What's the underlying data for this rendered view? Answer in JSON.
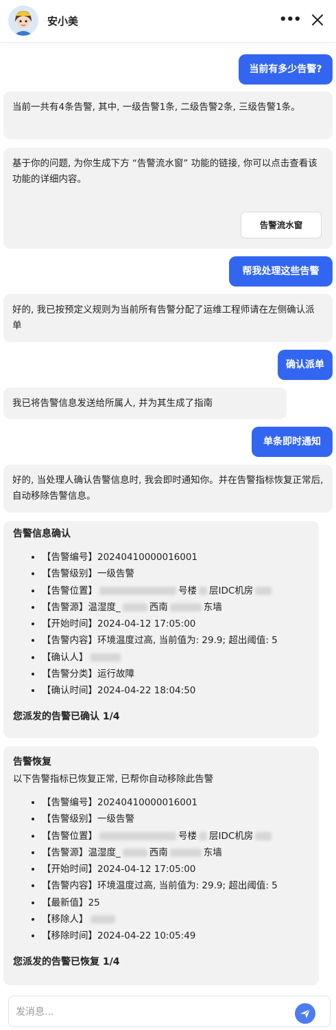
{
  "header": {
    "bot_name": "安小美"
  },
  "messages": {
    "u1": "当前有多少告警?",
    "b1": "当前一共有4条告警, 其中, 一级告警1条, 二级告警2条, 三级告警1条。",
    "b2": "基于你的问题, 为你生成下方 “告警流水窗” 功能的链接, 你可以点击查看该功能的详细内容。",
    "b2_button": "告警流水窗",
    "u2": "帮我处理这些告警",
    "b3": "好的, 我已按预定义规则为当前所有告警分配了运维工程师请在左侧确认派单",
    "u3": "确认派单",
    "b4": "我已将告警信息发送给所属人, 并为其生成了指南",
    "u4": "单条即时通知",
    "b5": "好的, 当处理人确认告警信息时, 我会即时通知你。并在告警指标恢复正常后, 自动移除告警信息。"
  },
  "confirm_card": {
    "title": "告警信息确认",
    "items": [
      "【告警编号】20240410000016001",
      "【告警级别】一级告警",
      "【告警位置】",
      "【告警源】温湿度_",
      "【开始时间】2024-04-12 17:05:00",
      "【告警内容】环境温度过高, 当前值为: 29.9; 超出阈值: 5",
      "【确认人】",
      "【告警分类】运行故障",
      "【确认时间】2024-04-22 18:04:50"
    ],
    "loc_mid1": "号楼",
    "loc_mid2": "层IDC机房",
    "src_mid1": "西南",
    "src_mid2": "东墙",
    "footer": "您派发的告警已确认 1/4"
  },
  "recover_card": {
    "title": "告警恢复",
    "subtitle": "以下告警指标已恢复正常, 已帮你自动移除此告警",
    "items": [
      "【告警编号】20240410000016001",
      "【告警级别】一级告警",
      "【告警位置】",
      "【告警源】温湿度_",
      "【开始时间】2024-04-12 17:05:00",
      "【告警内容】环境温度过高, 当前值为: 29.9; 超出阈值: 5",
      "【最新值】25",
      "【移除人】",
      "【移除时间】2024-04-22 10:05:49"
    ],
    "loc_mid1": "号楼",
    "loc_mid2": "层IDC机房",
    "src_mid1": "西南",
    "src_mid2": "东墙",
    "footer": "您派发的告警已恢复 1/4"
  },
  "input": {
    "placeholder": "发消息..."
  },
  "icons": {
    "more": "more-horizontal-icon",
    "close": "close-icon",
    "send": "send-icon"
  },
  "colors": {
    "accent": "#3366f0",
    "bubble": "#f2f2f2"
  }
}
